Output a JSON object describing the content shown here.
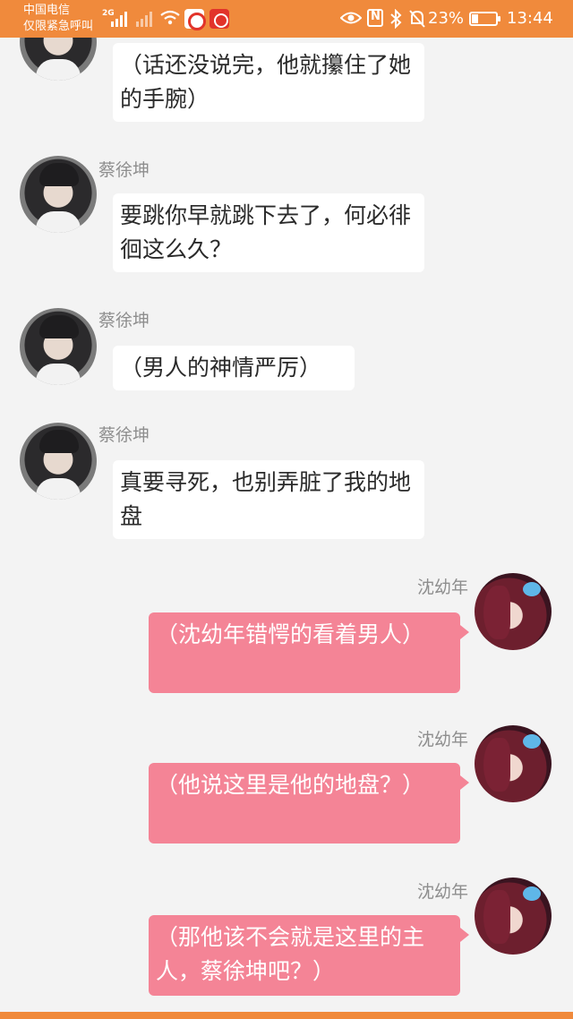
{
  "status_bar": {
    "carrier_line1": "中国电信",
    "carrier_line2": "仅限紧急呼叫",
    "network_type": "2G",
    "battery_percent": "23%",
    "battery_level": 0.23,
    "time": "13:44",
    "background_color": "#f08a3c"
  },
  "chat": {
    "messages": [
      {
        "side": "left",
        "sender": "",
        "text": "（话还没说完，他就攥住了她的手腕）"
      },
      {
        "side": "left",
        "sender": "蔡徐坤",
        "text": "要跳你早就跳下去了，何必徘徊这么久？"
      },
      {
        "side": "left",
        "sender": "蔡徐坤",
        "text": "（男人的神情严厉）"
      },
      {
        "side": "left",
        "sender": "蔡徐坤",
        "text": "真要寻死，也别弄脏了我的地盘"
      },
      {
        "side": "right",
        "sender": "沈幼年",
        "text": "（沈幼年错愕的看着男人）"
      },
      {
        "side": "right",
        "sender": "沈幼年",
        "text": "（他说这里是他的地盘？）"
      },
      {
        "side": "right",
        "sender": "沈幼年",
        "text": "（那他该不会就是这里的主人，蔡徐坤吧？）"
      }
    ],
    "left_bubble_color": "#ffffff",
    "right_bubble_color": "#f48496",
    "background_color": "#f3f3f3"
  }
}
